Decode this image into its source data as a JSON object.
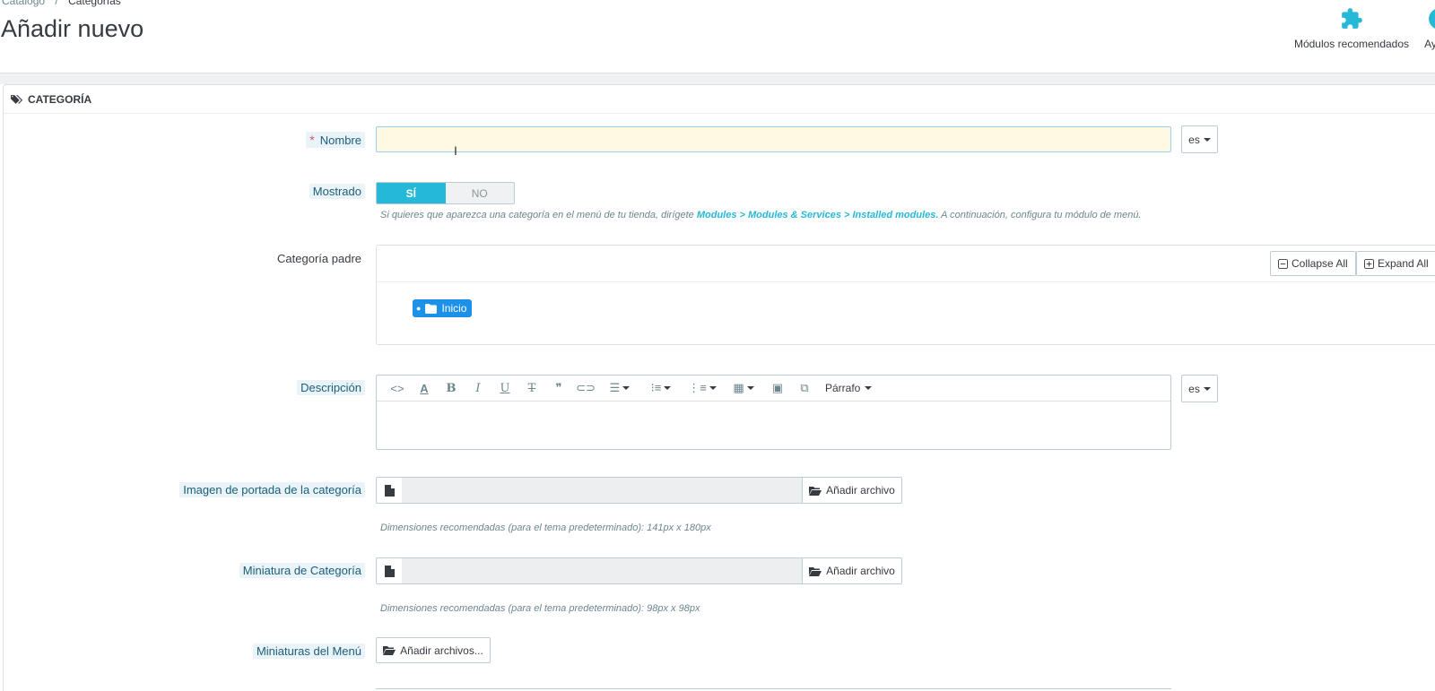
{
  "header": {
    "breadcrumb": [
      "Catálogo",
      "Categorías"
    ],
    "breadcrumb_sep": "/",
    "title": "Añadir nuevo",
    "toolbar": {
      "modules_label": "Módulos recomendados",
      "help_label": "Ayuda"
    }
  },
  "panel": {
    "heading": "CATEGORÍA",
    "name": {
      "label": "Nombre",
      "required_mark": "*",
      "value": "",
      "lang": "es"
    },
    "displayed": {
      "label": "Mostrado",
      "yes": "SÍ",
      "no": "NO",
      "selected": "SÍ",
      "help_prefix": "Si quieres que aparezca una categoría en el menú de tu tienda, dirígete ",
      "help_link": "Modules > Modules & Services > Installed modules.",
      "help_suffix": " A continuación, configura tu módulo de menú."
    },
    "parent": {
      "label": "Categoría padre",
      "collapse_all": "Collapse All",
      "expand_all": "Expand All",
      "root_node": "Inicio"
    },
    "description": {
      "label": "Descripción",
      "format_select": "Párrafo",
      "lang": "es"
    },
    "cover_image": {
      "label": "Imagen de portada de la categoría",
      "button": "Añadir archivo",
      "help": "Dimensiones recomendadas (para el tema predeterminado): 141px x 180px"
    },
    "thumbnail": {
      "label": "Miniatura de Categoría",
      "button": "Añadir archivo",
      "help": "Dimensiones recomendadas (para el tema predeterminado): 98px x 98px"
    },
    "menu_thumbnails": {
      "label": "Miniaturas del Menú",
      "button": "Añadir archivos..."
    }
  },
  "colors": {
    "accent": "#25b9d7",
    "tree_node": "#1d90e8",
    "input_bg": "#fef9e2",
    "label_help_bg": "#eaf3f7",
    "required": "#c05c67"
  }
}
